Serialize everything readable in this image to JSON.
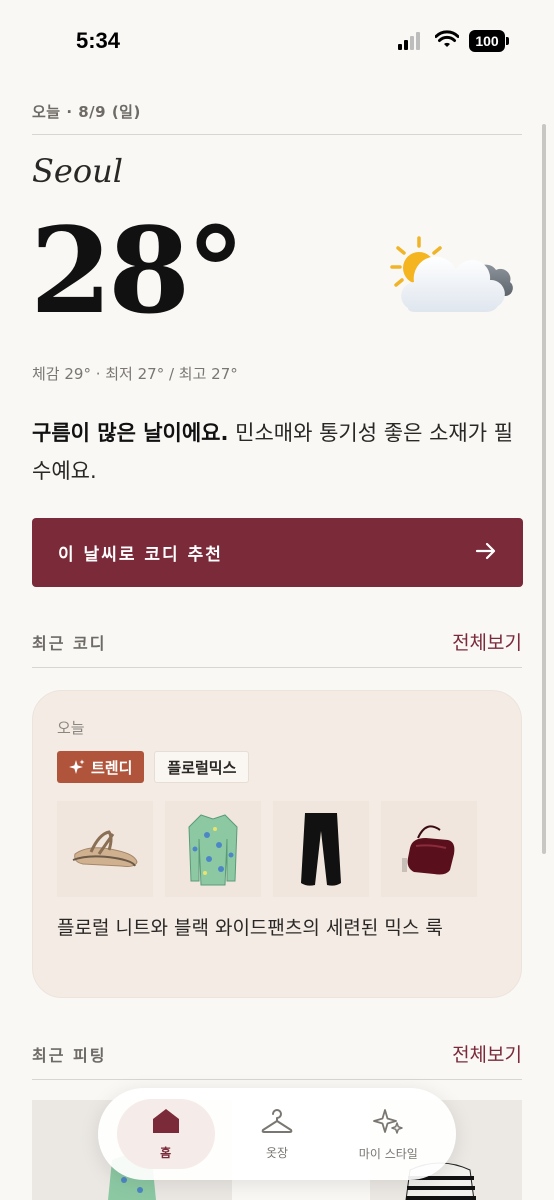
{
  "status": {
    "time": "5:34",
    "battery": "100"
  },
  "header": {
    "date_label": "오늘 · 8/9 (일)"
  },
  "weather": {
    "city": "Seoul",
    "temperature": "28°",
    "icon": "partly-cloudy-icon",
    "feels_line": "체감 29° · 최저 27° / 최고 27°",
    "summary_bold": "구름이 많은 날이에요.",
    "summary_rest": " 민소매와 통기성 좋은 소재가 필수예요."
  },
  "cta": {
    "label": "이 날씨로 코디 추천",
    "icon": "arrow-right-icon"
  },
  "recent_coordi": {
    "title": "최근 코디",
    "view_all": "전체보기",
    "card": {
      "date": "오늘",
      "tags": [
        {
          "label": "트렌디",
          "icon": "sparkle-icon"
        },
        {
          "label": "플로럴믹스"
        }
      ],
      "items": [
        "sandal-icon",
        "floral-knit-icon",
        "wide-pants-icon",
        "shoulder-bag-icon"
      ],
      "description": "플로럴 니트와 블랙 와이드팬츠의 세련된 믹스 룩"
    }
  },
  "recent_fitting": {
    "title": "최근 피팅",
    "view_all": "전체보기"
  },
  "tabbar": {
    "items": [
      {
        "label": "홈",
        "icon": "home-icon",
        "active": true
      },
      {
        "label": "옷장",
        "icon": "hanger-icon"
      },
      {
        "label": "마이 스타일",
        "icon": "sparkle-icon"
      }
    ]
  },
  "colors": {
    "accent": "#7b2a3a",
    "tag_primary": "#b0553b",
    "card_bg": "#f4ebe4",
    "page_bg": "#faf8f5"
  }
}
